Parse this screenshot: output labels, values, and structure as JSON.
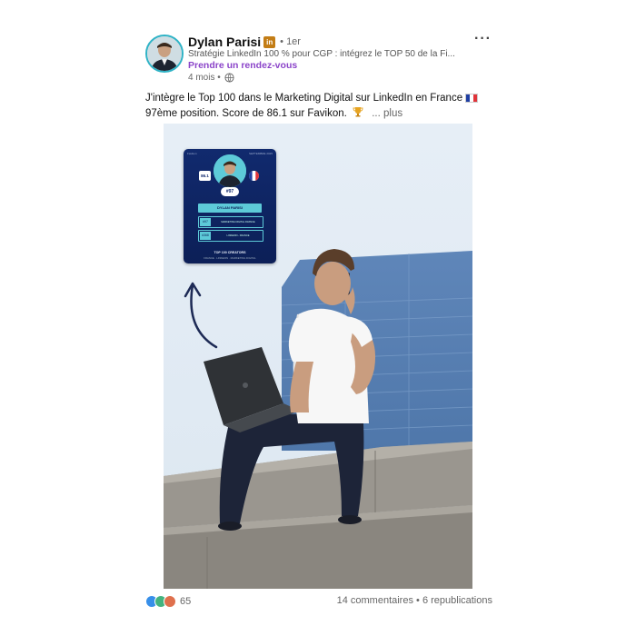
{
  "author": {
    "name": "Dylan Parisi",
    "badge": "in",
    "degree": "• 1er",
    "headline": "Stratégie LinkedIn 100 % pour CGP : intégrez le TOP 50 de la Fi...",
    "cta": "Prendre un rendez-vous",
    "time": "4 mois •"
  },
  "post": {
    "line1": "J'intègre le Top 100 dans le Marketing Digital sur LinkedIn en France",
    "line2": "97ème position. Score de 86.1 sur Favikon.",
    "see_more": "... plus"
  },
  "card": {
    "brand": "Favikon",
    "date": "SEPTEMBRE 2025",
    "score": "86.1",
    "rank": "#97",
    "name": "DYLAN PARISI",
    "row1_label": "#97",
    "row1_text": "MARKETING DIGITAL FRANCE",
    "row2_label": "#368",
    "row2_text": "LINKEDIN - FRANCE",
    "footer": "TOP 100 CREATORS",
    "footer_sub": "FRANCE · LINKEDIN · MARKETING DIGITAL"
  },
  "footer": {
    "reactions_count": "65",
    "comments": "14 commentaires",
    "separator": " • ",
    "reposts": "6 republications"
  },
  "colors": {
    "accent_purple": "#8b44c9",
    "avatar_ring": "#2fb3c6",
    "card_bg": "#0c1f57",
    "card_accent": "#5dcad8"
  }
}
